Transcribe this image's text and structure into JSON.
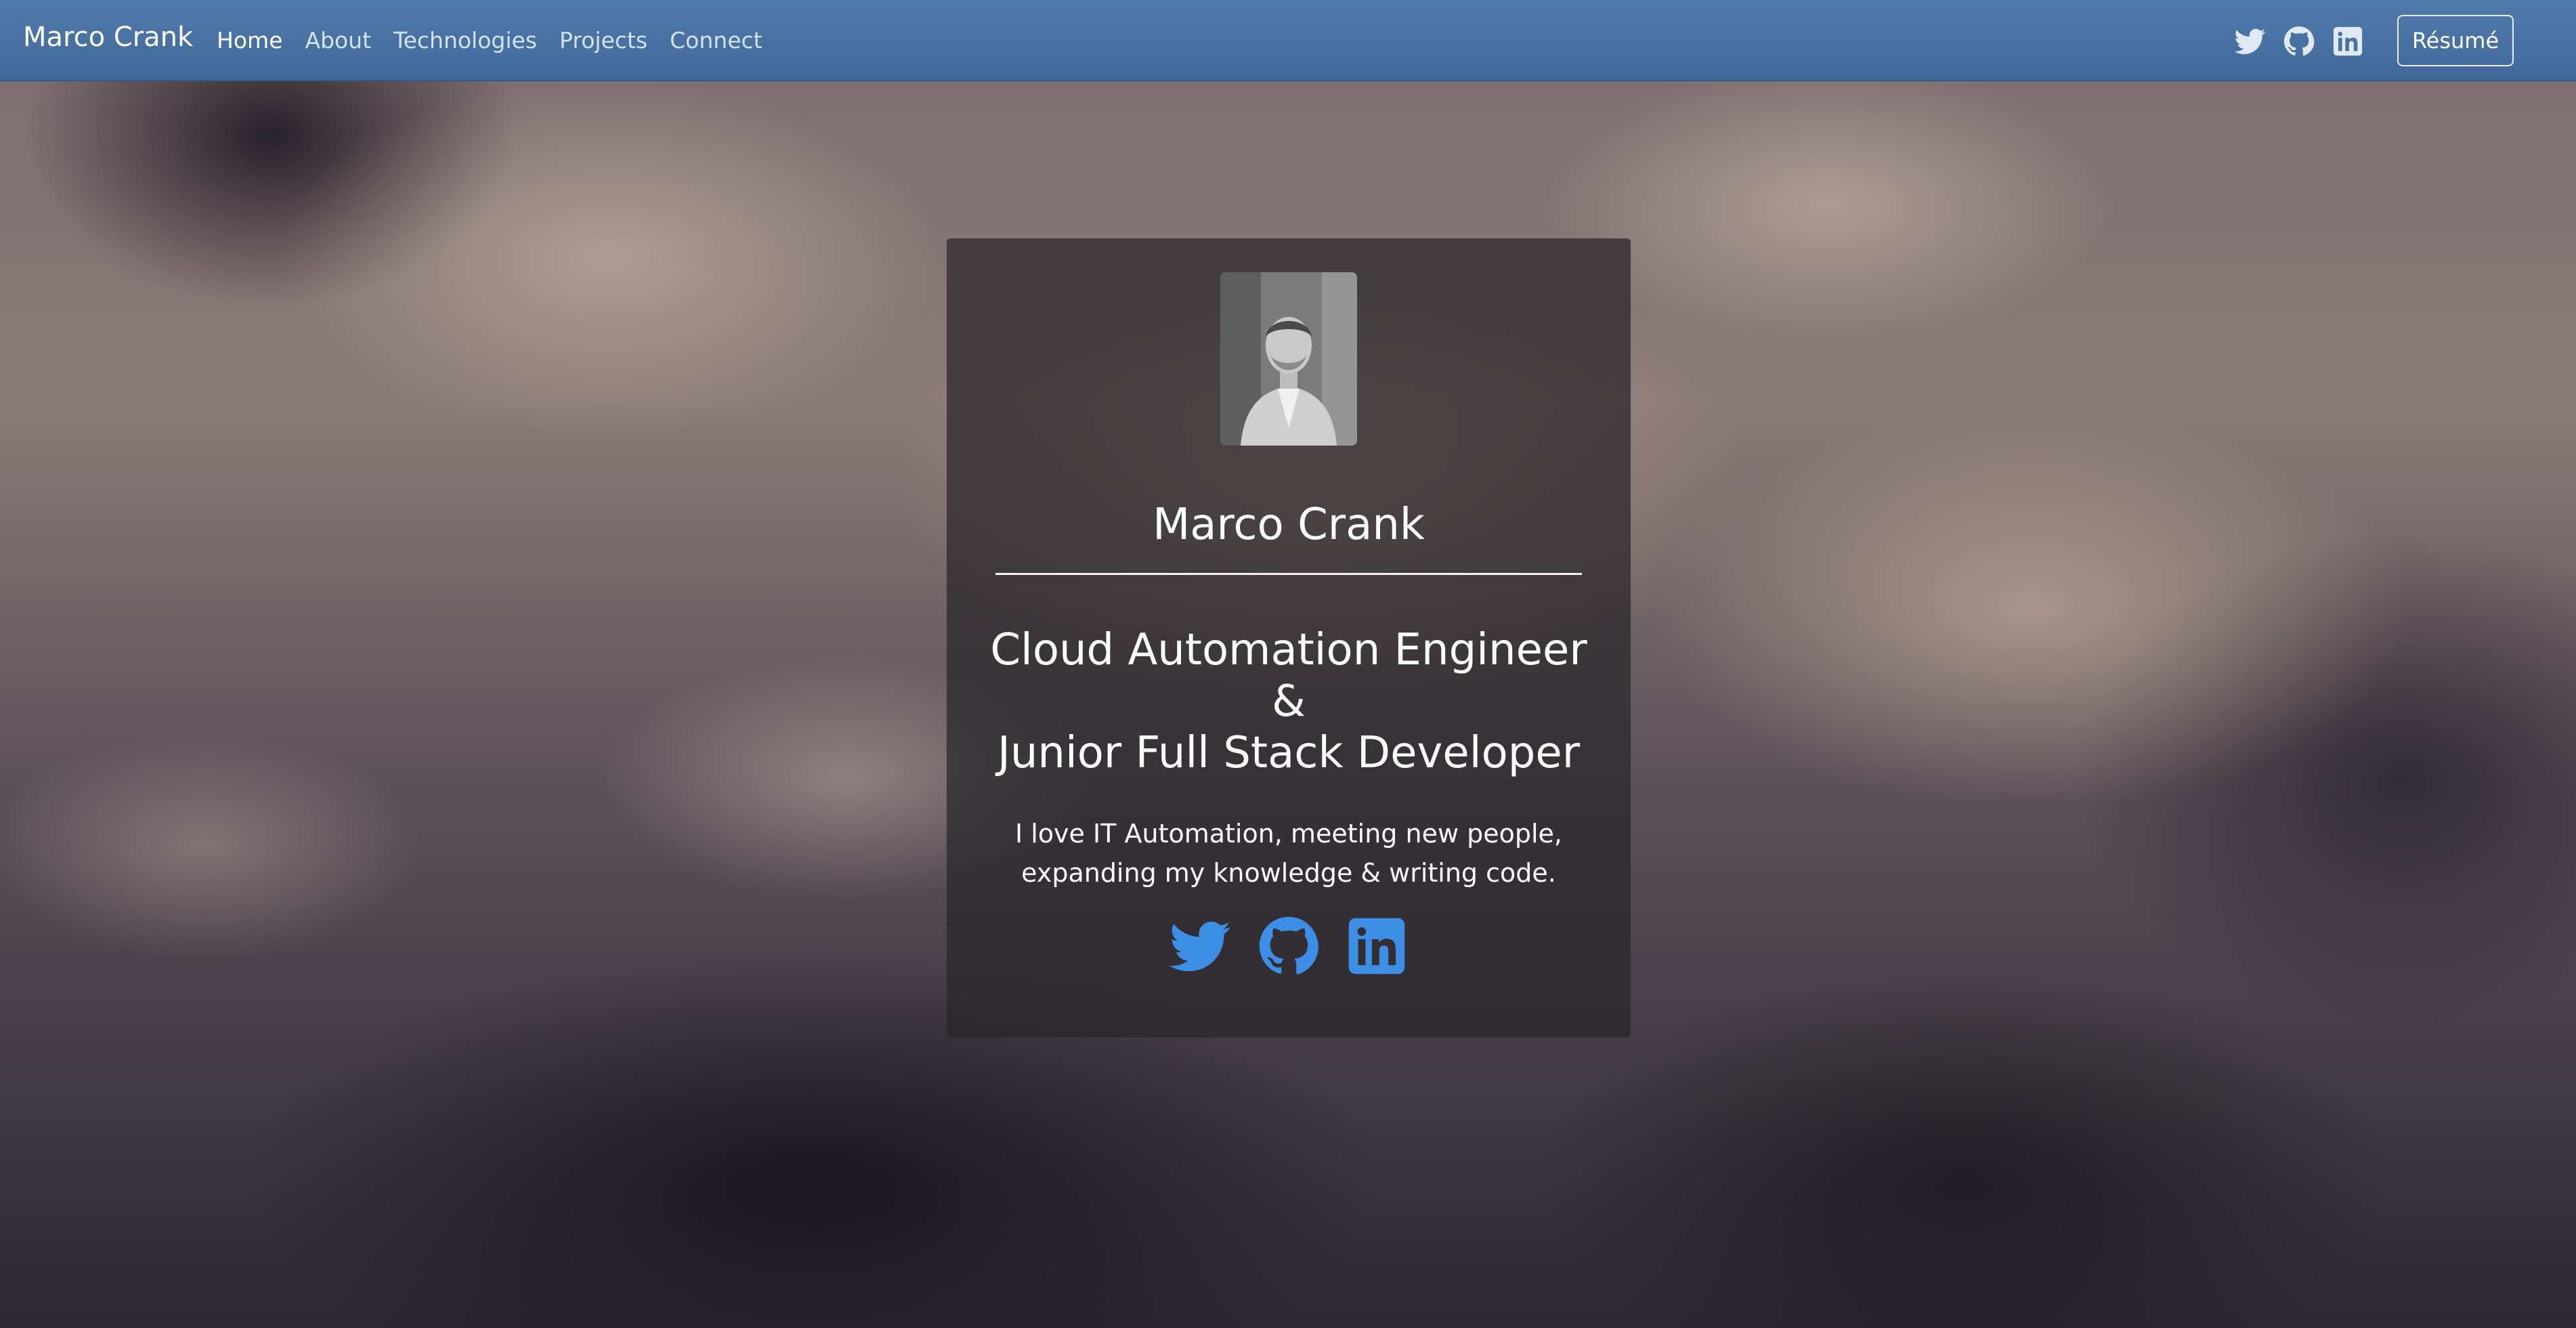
{
  "nav": {
    "brand": "Marco Crank",
    "links": [
      {
        "label": "Home",
        "active": true
      },
      {
        "label": "About"
      },
      {
        "label": "Technologies"
      },
      {
        "label": "Projects"
      },
      {
        "label": "Connect"
      }
    ],
    "icons": [
      "twitter-icon",
      "github-icon",
      "linkedin-icon"
    ],
    "resume_label": "Résumé"
  },
  "card": {
    "name": "Marco Crank",
    "role_lines": [
      "Cloud Automation Engineer",
      "&",
      "Junior Full Stack Developer"
    ],
    "bio_lines": [
      "I love IT Automation, meeting new people,",
      "expanding my knowledge & writing code."
    ],
    "icons": [
      "twitter-icon",
      "github-icon",
      "linkedin-icon"
    ]
  },
  "colors": {
    "navbar": "#4a75a5",
    "card_icon": "#3d8fe6",
    "card_background": "rgba(40,38,42,0.72)"
  }
}
